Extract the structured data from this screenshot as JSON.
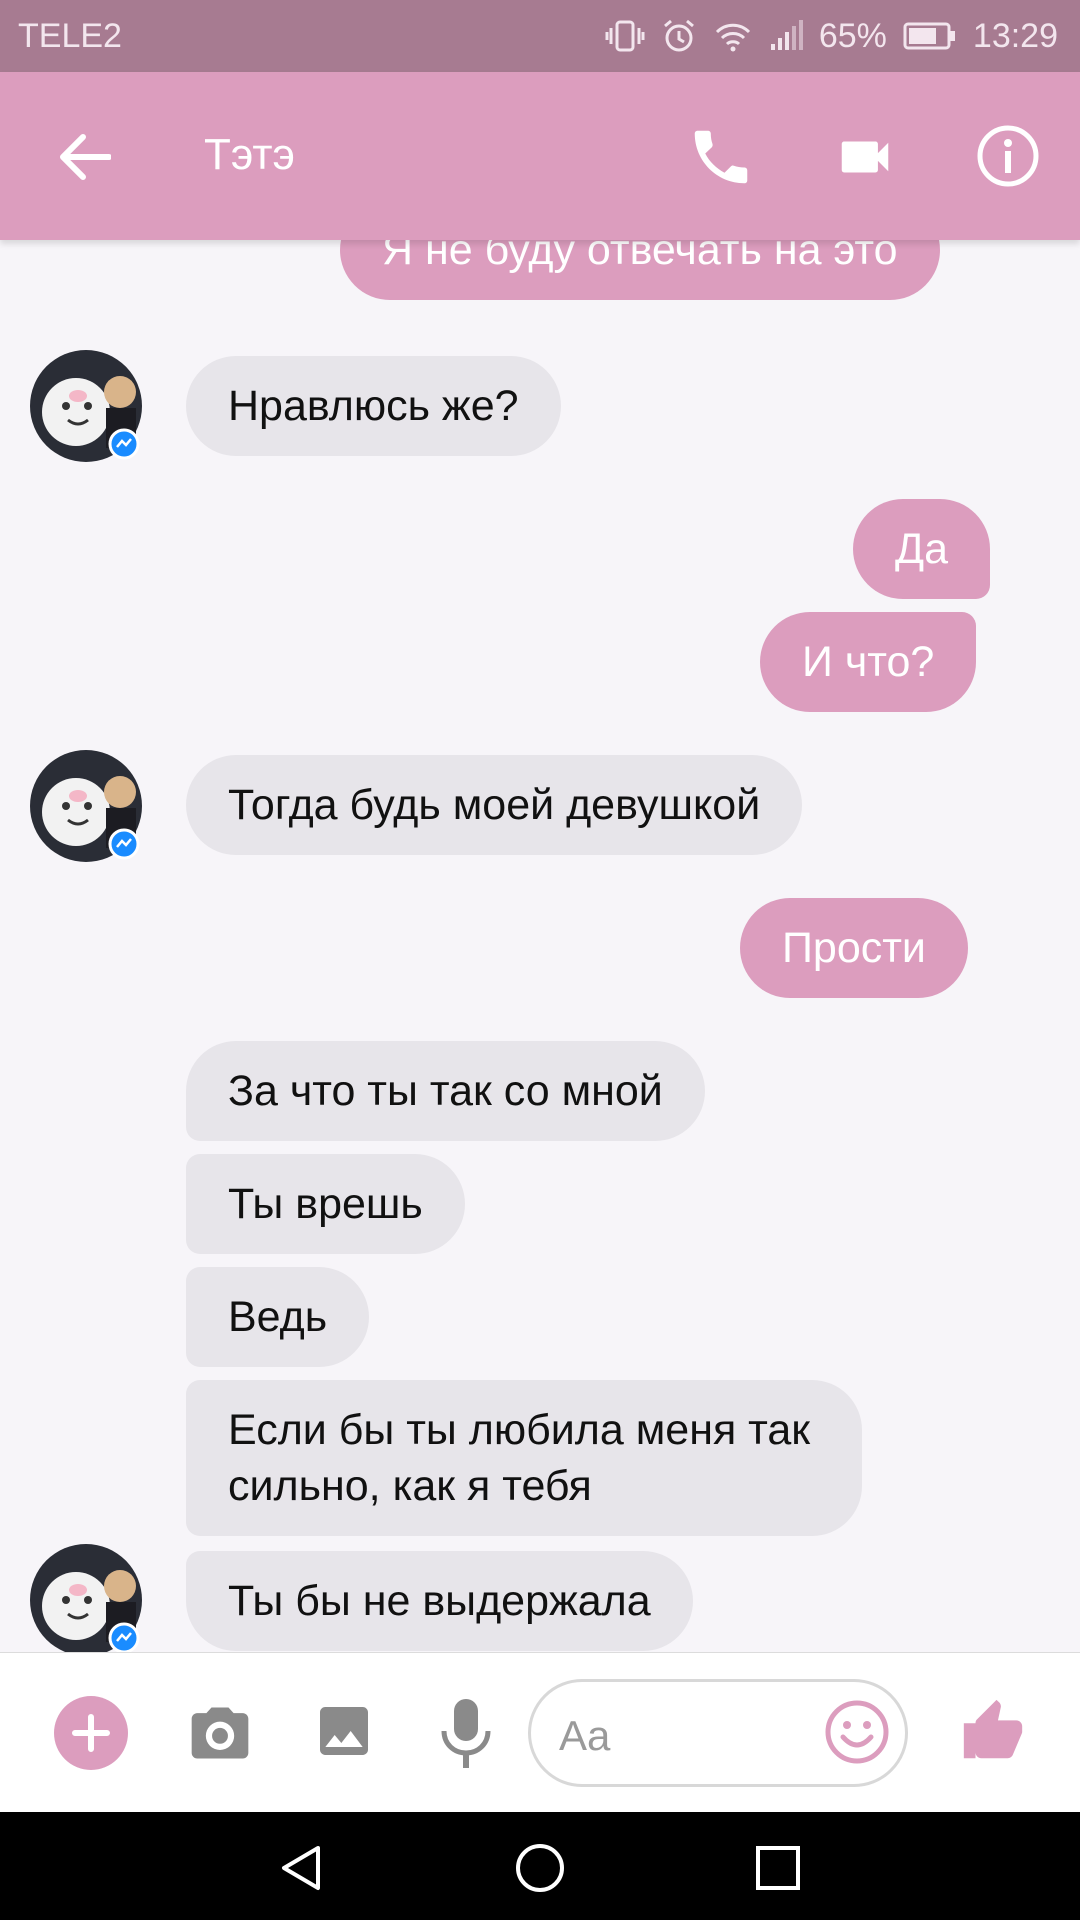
{
  "status_bar": {
    "carrier": "TELE2",
    "battery": "65%",
    "time": "13:29"
  },
  "header": {
    "title": "Тэтэ",
    "icons": [
      "back-arrow-icon",
      "phone-icon",
      "video-camera-icon",
      "info-icon"
    ]
  },
  "messages": [
    {
      "side": "out",
      "text": "Я не буду отвечать на это"
    },
    {
      "side": "in",
      "text": "Нравлюсь же?"
    },
    {
      "side": "out",
      "text": "Да"
    },
    {
      "side": "out",
      "text": "И что?"
    },
    {
      "side": "in",
      "text": "Тогда будь моей девушкой"
    },
    {
      "side": "out",
      "text": "Прости"
    },
    {
      "side": "in",
      "text": "За что ты так со мной"
    },
    {
      "side": "in",
      "text": "Ты врешь"
    },
    {
      "side": "in",
      "text": "Ведь"
    },
    {
      "side": "in",
      "text_line1": "Если бы ты любила меня так",
      "text_line2": "сильно, как я тебя"
    },
    {
      "side": "in",
      "text": "Ты бы не выдержала"
    }
  ],
  "composer": {
    "placeholder": "Aa",
    "icons": [
      "plus-icon",
      "camera-icon",
      "image-icon",
      "microphone-icon",
      "emoji-icon",
      "thumbs-up-icon"
    ]
  },
  "nav_bar": {
    "icons": [
      "back-triangle-icon",
      "home-circle-icon",
      "recents-square-icon"
    ]
  },
  "colors": {
    "accent": "#dc9dbe",
    "status_bar": "#a77b91",
    "incoming_bubble": "#e7e5ea",
    "background": "#f7f5f9"
  }
}
